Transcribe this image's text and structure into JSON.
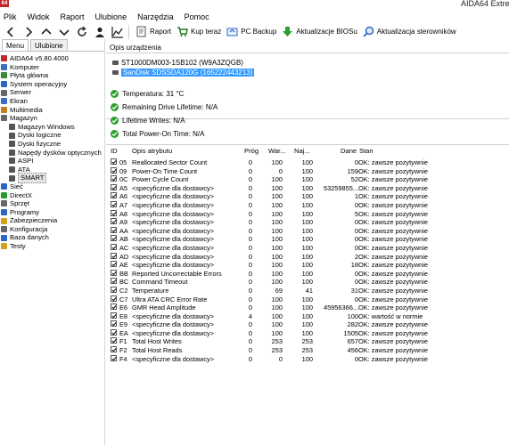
{
  "window": {
    "app_icon_text": "64",
    "title": "AIDA64 Extre"
  },
  "menu": [
    "Plik",
    "Widok",
    "Raport",
    "Ulubione",
    "Narzędzia",
    "Pomoc"
  ],
  "toolbar": {
    "raport": "Raport",
    "kup_teraz": "Kup teraz",
    "pc_backup": "PC Backup",
    "aktualizacje_bios": "Aktualizacje BIOSu",
    "aktualizacja_sterownikow": "Aktualizacja sterowników"
  },
  "left_tabs": {
    "menu": "Menu",
    "ulubione": "Ulubione"
  },
  "tree": [
    {
      "label": "AIDA64 v5.80.4000",
      "indent": 0,
      "color": "#c0282d"
    },
    {
      "label": "Komputer",
      "indent": 0,
      "color": "#3b6fc4"
    },
    {
      "label": "Płyta główna",
      "indent": 0,
      "color": "#3a8a3a"
    },
    {
      "label": "System operacyjny",
      "indent": 0,
      "color": "#2a66c9"
    },
    {
      "label": "Serwer",
      "indent": 0,
      "color": "#666666"
    },
    {
      "label": "Ekran",
      "indent": 0,
      "color": "#3b6fc4"
    },
    {
      "label": "Multimedia",
      "indent": 0,
      "color": "#c97a1a"
    },
    {
      "label": "Magazyn",
      "indent": 0,
      "color": "#666666"
    },
    {
      "label": "Magazyn Windows",
      "indent": 1,
      "color": "#555555"
    },
    {
      "label": "Dyski logiczne",
      "indent": 1,
      "color": "#555555"
    },
    {
      "label": "Dyski fizyczne",
      "indent": 1,
      "color": "#555555"
    },
    {
      "label": "Napędy dysków optycznych",
      "indent": 1,
      "color": "#555555"
    },
    {
      "label": "ASPI",
      "indent": 1,
      "color": "#555555"
    },
    {
      "label": "ATA",
      "indent": 1,
      "color": "#555555"
    },
    {
      "label": "SMART",
      "indent": 1,
      "color": "#555555",
      "selected": true
    },
    {
      "label": "Sieć",
      "indent": 0,
      "color": "#2a66c9"
    },
    {
      "label": "DirectX",
      "indent": 0,
      "color": "#2a9a2a"
    },
    {
      "label": "Sprzęt",
      "indent": 0,
      "color": "#666666"
    },
    {
      "label": "Programy",
      "indent": 0,
      "color": "#2a66c9"
    },
    {
      "label": "Zabezpieczenia",
      "indent": 0,
      "color": "#d4a017"
    },
    {
      "label": "Konfiguracja",
      "indent": 0,
      "color": "#666666"
    },
    {
      "label": "Baza danych",
      "indent": 0,
      "color": "#2a66c9"
    },
    {
      "label": "Testy",
      "indent": 0,
      "color": "#d0a020"
    }
  ],
  "devices": {
    "header": "Opis urządzenia",
    "items": [
      {
        "label": "ST1000DM003-1SB102 (W9A3ZQGB)",
        "selected": false
      },
      {
        "label": "SanDisk SDSSDA120G (165222443213)",
        "selected": true
      }
    ]
  },
  "status_lines": [
    "Temperatura: 31 °C",
    "Remaining Drive Lifetime: N/A",
    "Lifetime Writes: N/A",
    "Total Power-On Time: N/A"
  ],
  "table": {
    "headers": {
      "id": "ID",
      "name": "Opis atrybutu",
      "prog": "Próg",
      "war": "War...",
      "naj": "Naj...",
      "dane": "Dane",
      "stan": "Stan"
    },
    "rows": [
      {
        "id": "05",
        "name": "Reallocated Sector Count",
        "prog": "0",
        "war": "100",
        "naj": "100",
        "dane": "0",
        "stan": "OK: zawsze pozytywnie"
      },
      {
        "id": "09",
        "name": "Power-On Time Count",
        "prog": "0",
        "war": "0",
        "naj": "100",
        "dane": "159",
        "stan": "OK: zawsze pozytywnie"
      },
      {
        "id": "0C",
        "name": "Power Cycle Count",
        "prog": "0",
        "war": "100",
        "naj": "100",
        "dane": "52",
        "stan": "OK: zawsze pozytywnie"
      },
      {
        "id": "A5",
        "name": "<specyficzne dla dostawcy>",
        "prog": "0",
        "war": "100",
        "naj": "100",
        "dane": "53259855...",
        "stan": "OK: zawsze pozytywnie"
      },
      {
        "id": "A6",
        "name": "<specyficzne dla dostawcy>",
        "prog": "0",
        "war": "100",
        "naj": "100",
        "dane": "1",
        "stan": "OK: zawsze pozytywnie"
      },
      {
        "id": "A7",
        "name": "<specyficzne dla dostawcy>",
        "prog": "0",
        "war": "100",
        "naj": "100",
        "dane": "0",
        "stan": "OK: zawsze pozytywnie"
      },
      {
        "id": "A8",
        "name": "<specyficzne dla dostawcy>",
        "prog": "0",
        "war": "100",
        "naj": "100",
        "dane": "5",
        "stan": "OK: zawsze pozytywnie"
      },
      {
        "id": "A9",
        "name": "<specyficzne dla dostawcy>",
        "prog": "0",
        "war": "100",
        "naj": "100",
        "dane": "0",
        "stan": "OK: zawsze pozytywnie"
      },
      {
        "id": "AA",
        "name": "<specyficzne dla dostawcy>",
        "prog": "0",
        "war": "100",
        "naj": "100",
        "dane": "0",
        "stan": "OK: zawsze pozytywnie"
      },
      {
        "id": "AB",
        "name": "<specyficzne dla dostawcy>",
        "prog": "0",
        "war": "100",
        "naj": "100",
        "dane": "0",
        "stan": "OK: zawsze pozytywnie"
      },
      {
        "id": "AC",
        "name": "<specyficzne dla dostawcy>",
        "prog": "0",
        "war": "100",
        "naj": "100",
        "dane": "0",
        "stan": "OK: zawsze pozytywnie"
      },
      {
        "id": "AD",
        "name": "<specyficzne dla dostawcy>",
        "prog": "0",
        "war": "100",
        "naj": "100",
        "dane": "2",
        "stan": "OK: zawsze pozytywnie"
      },
      {
        "id": "AE",
        "name": "<specyficzne dla dostawcy>",
        "prog": "0",
        "war": "100",
        "naj": "100",
        "dane": "18",
        "stan": "OK: zawsze pozytywnie"
      },
      {
        "id": "BB",
        "name": "Reported Uncorrectable Errors",
        "prog": "0",
        "war": "100",
        "naj": "100",
        "dane": "0",
        "stan": "OK: zawsze pozytywnie"
      },
      {
        "id": "BC",
        "name": "Command Timeout",
        "prog": "0",
        "war": "100",
        "naj": "100",
        "dane": "0",
        "stan": "OK: zawsze pozytywnie"
      },
      {
        "id": "C2",
        "name": "Temperature",
        "prog": "0",
        "war": "69",
        "naj": "41",
        "dane": "31",
        "stan": "OK: zawsze pozytywnie"
      },
      {
        "id": "C7",
        "name": "Ultra ATA CRC Error Rate",
        "prog": "0",
        "war": "100",
        "naj": "100",
        "dane": "0",
        "stan": "OK: zawsze pozytywnie"
      },
      {
        "id": "E6",
        "name": "GMR Head Amplitude",
        "prog": "0",
        "war": "100",
        "naj": "100",
        "dane": "45956366...",
        "stan": "OK: zawsze pozytywnie"
      },
      {
        "id": "E8",
        "name": "<specyficzne dla dostawcy>",
        "prog": "4",
        "war": "100",
        "naj": "100",
        "dane": "100",
        "stan": "OK: wartość w normie"
      },
      {
        "id": "E9",
        "name": "<specyficzne dla dostawcy>",
        "prog": "0",
        "war": "100",
        "naj": "100",
        "dane": "282",
        "stan": "OK: zawsze pozytywnie"
      },
      {
        "id": "EA",
        "name": "<specyficzne dla dostawcy>",
        "prog": "0",
        "war": "100",
        "naj": "100",
        "dane": "1505",
        "stan": "OK: zawsze pozytywnie"
      },
      {
        "id": "F1",
        "name": "Total Host Writes",
        "prog": "0",
        "war": "253",
        "naj": "253",
        "dane": "657",
        "stan": "OK: zawsze pozytywnie"
      },
      {
        "id": "F2",
        "name": "Total Host Reads",
        "prog": "0",
        "war": "253",
        "naj": "253",
        "dane": "456",
        "stan": "OK: zawsze pozytywnie"
      },
      {
        "id": "F4",
        "name": "<specyficzne dla dostawcy>",
        "prog": "0",
        "war": "0",
        "naj": "100",
        "dane": "0",
        "stan": "OK: zawsze pozytywnie"
      }
    ]
  }
}
